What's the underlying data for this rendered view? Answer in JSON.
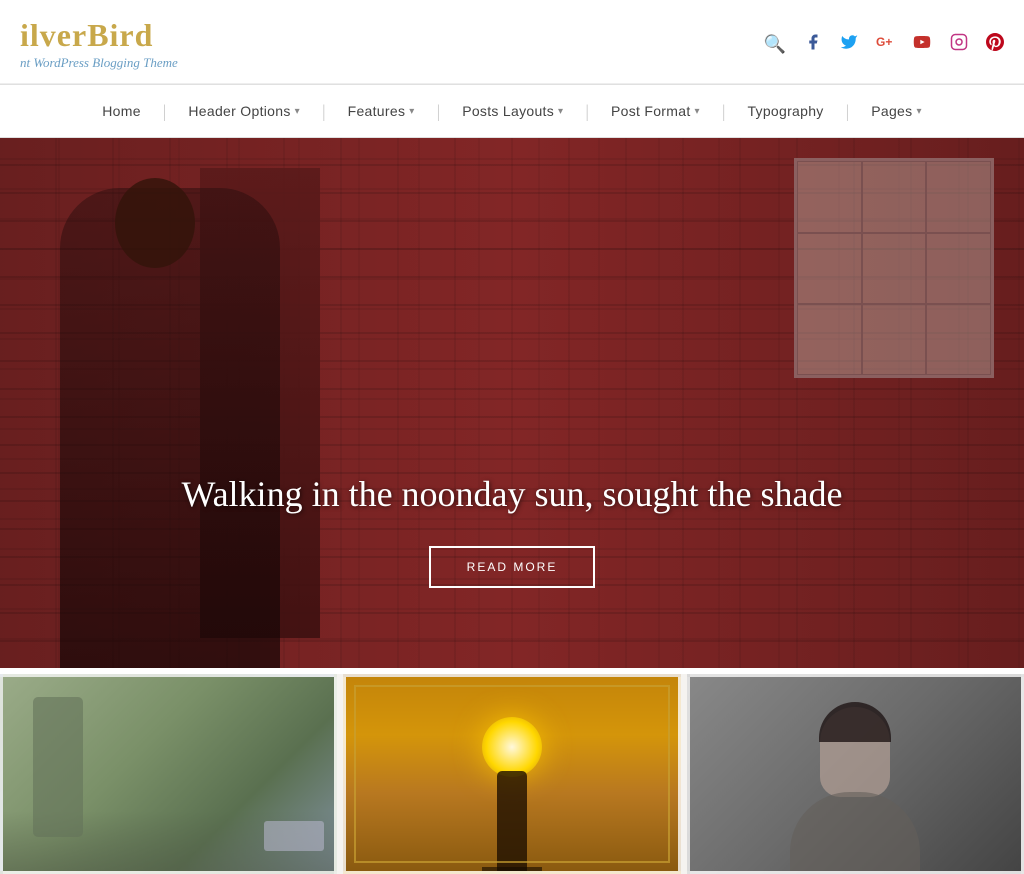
{
  "site": {
    "logo": "ilverBird",
    "tagline": "nt WordPress Blogging Theme"
  },
  "social": {
    "search": "🔍",
    "facebook": "f",
    "twitter": "t",
    "google": "G+",
    "youtube": "▶",
    "instagram": "📷",
    "pinterest": "P"
  },
  "nav": {
    "items": [
      {
        "label": "Home",
        "has_dropdown": false
      },
      {
        "label": "Header Options",
        "has_dropdown": true
      },
      {
        "label": "Features",
        "has_dropdown": true
      },
      {
        "label": "Posts Layouts",
        "has_dropdown": true
      },
      {
        "label": "Post Format",
        "has_dropdown": true
      },
      {
        "label": "Typography",
        "has_dropdown": false
      },
      {
        "label": "Pages",
        "has_dropdown": true
      }
    ]
  },
  "hero": {
    "title": "Walking in the noonday sun, sought the shade",
    "cta_label": "READ MORE"
  },
  "thumbnails": [
    {
      "id": "thumb-1",
      "style": "outdoor"
    },
    {
      "id": "thumb-2",
      "style": "golden"
    },
    {
      "id": "thumb-3",
      "style": "portrait"
    }
  ]
}
